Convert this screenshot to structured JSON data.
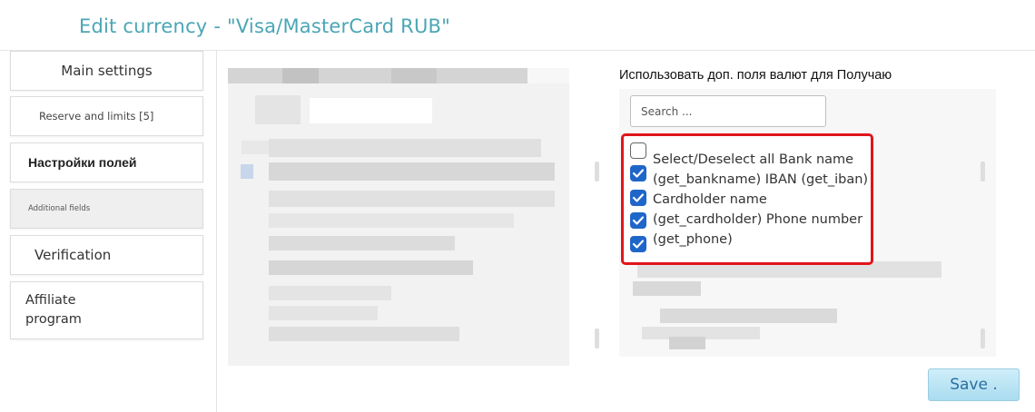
{
  "page": {
    "title": "Edit currency - \"Visa/MasterCard RUB\""
  },
  "sidebar": {
    "items": [
      {
        "label": "Main settings",
        "active": false
      },
      {
        "label": "Reserve and limits [5]",
        "active": false
      },
      {
        "label": "Настройки полей",
        "active": false
      },
      {
        "label": "Additional fields",
        "active": true
      },
      {
        "label": "Verification",
        "active": false
      },
      {
        "label": "Affiliate\nprogram",
        "active": false
      }
    ]
  },
  "receive_fields": {
    "heading": "Использовать доп. поля валют для Получаю",
    "search_placeholder": "Search ...",
    "option_text": "Select/Deselect all Bank name (get_bankname) IBAN (get_iban) Cardholder name (get_cardholder) Phone number (get_phone)",
    "checkbox_states": [
      false,
      true,
      true,
      true,
      true
    ]
  },
  "actions": {
    "save_label": "Save ."
  },
  "colors": {
    "title": "#4aa6b5",
    "highlight_border": "#e0151b",
    "checkbox_checked": "#1f66c9",
    "save_bg": "#bde6f5"
  }
}
